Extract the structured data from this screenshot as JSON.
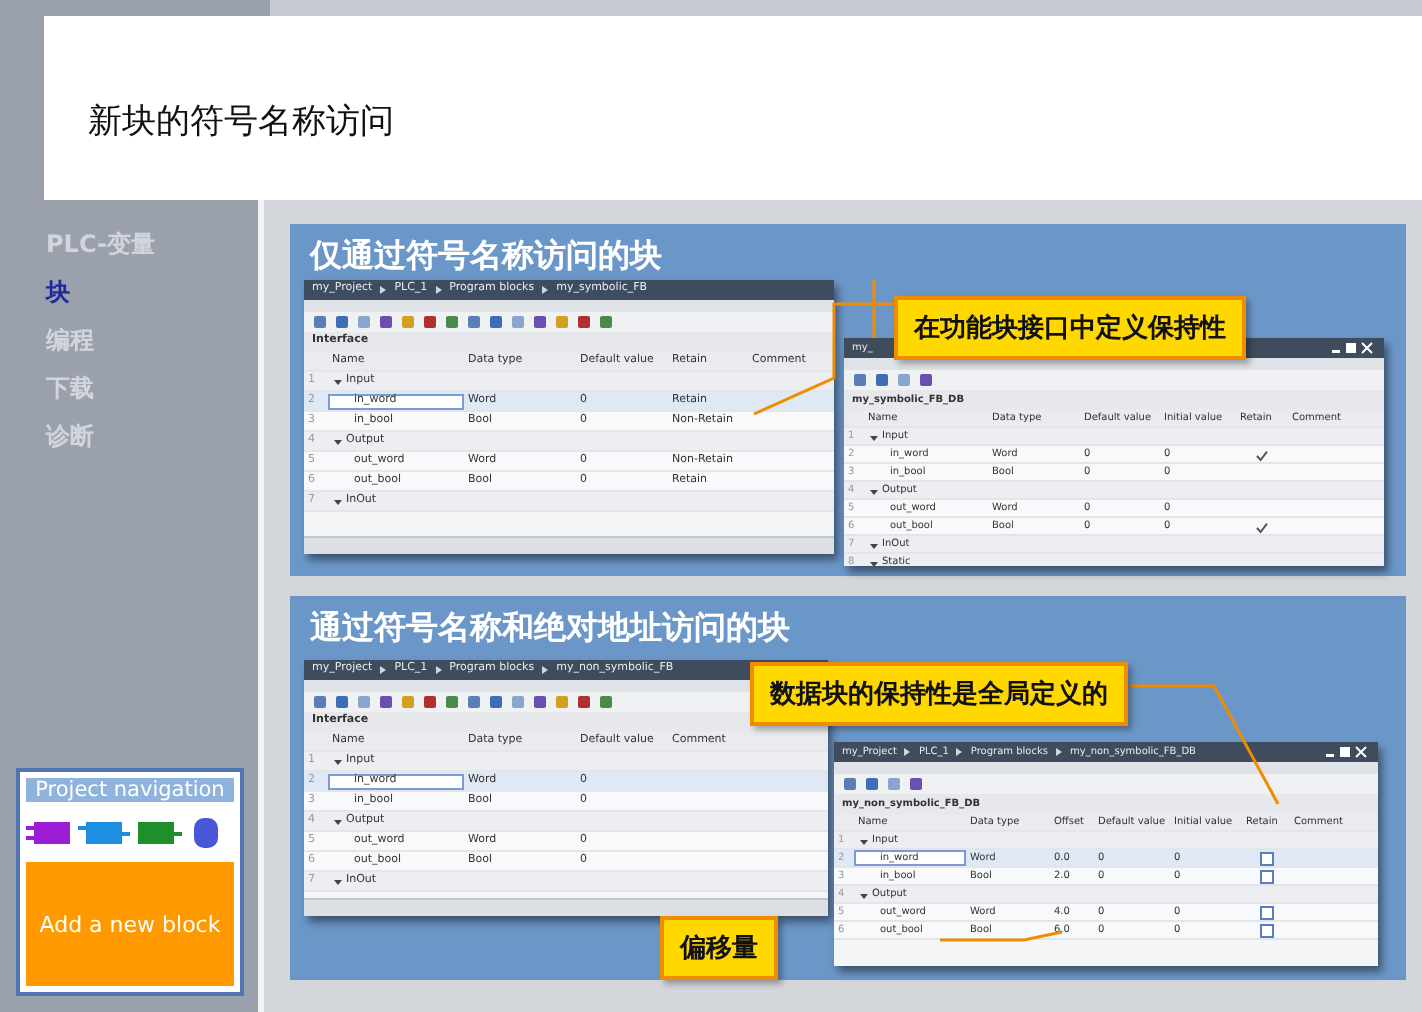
{
  "title": "新块的符号名称访问",
  "nav": [
    {
      "label": "PLC-变量",
      "selected": false
    },
    {
      "label": "块",
      "selected": true
    },
    {
      "label": "编程",
      "selected": false
    },
    {
      "label": "下载",
      "selected": false
    },
    {
      "label": "诊断",
      "selected": false
    }
  ],
  "project_navigation": {
    "title": "Project navigation",
    "button": "Add a new block"
  },
  "sections": [
    {
      "heading": "仅通过符号名称访问的块",
      "editor": {
        "breadcrumb": [
          "my_Project",
          "PLC_1",
          "Program blocks",
          "my_symbolic_FB"
        ],
        "section_title": "Interface",
        "columns": [
          "Name",
          "Data type",
          "Default value",
          "Retain",
          "Comment"
        ],
        "rows": [
          {
            "num": "1",
            "kind": "group",
            "name": "Input",
            "selected": false
          },
          {
            "num": "2",
            "kind": "var",
            "name": "in_word",
            "selected": true,
            "cells": [
              "Word",
              "0",
              "Retain"
            ]
          },
          {
            "num": "3",
            "kind": "var",
            "name": "in_bool",
            "selected": false,
            "cells": [
              "Bool",
              "0",
              "Non-Retain"
            ]
          },
          {
            "num": "4",
            "kind": "group",
            "name": "Output",
            "selected": false
          },
          {
            "num": "5",
            "kind": "var",
            "name": "out_word",
            "selected": false,
            "cells": [
              "Word",
              "0",
              "Non-Retain"
            ]
          },
          {
            "num": "6",
            "kind": "var",
            "name": "out_bool",
            "selected": false,
            "cells": [
              "Bool",
              "0",
              "Retain"
            ]
          },
          {
            "num": "7",
            "kind": "group",
            "name": "InOut",
            "selected": false
          }
        ]
      },
      "db": {
        "breadcrumb": [
          "my_"
        ],
        "section_title": "my_symbolic_FB_DB",
        "kind": "ticks",
        "columns": [
          "Name",
          "Data type",
          "Default value",
          "Initial value",
          "Retain",
          "Comment"
        ],
        "rows": [
          {
            "num": "1",
            "kind": "group",
            "name": "Input",
            "selected": false
          },
          {
            "num": "2",
            "kind": "var",
            "name": "in_word",
            "selected": false,
            "cells": [
              "Word",
              "0",
              "0"
            ],
            "retain": true
          },
          {
            "num": "3",
            "kind": "var",
            "name": "in_bool",
            "selected": false,
            "cells": [
              "Bool",
              "0",
              "0"
            ],
            "retain": false
          },
          {
            "num": "4",
            "kind": "group",
            "name": "Output",
            "selected": false
          },
          {
            "num": "5",
            "kind": "var",
            "name": "out_word",
            "selected": false,
            "cells": [
              "Word",
              "0",
              "0"
            ],
            "retain": false
          },
          {
            "num": "6",
            "kind": "var",
            "name": "out_bool",
            "selected": false,
            "cells": [
              "Bool",
              "0",
              "0"
            ],
            "retain": true
          },
          {
            "num": "7",
            "kind": "group",
            "name": "InOut",
            "selected": false
          },
          {
            "num": "8",
            "kind": "group",
            "name": "Static",
            "selected": false
          }
        ]
      },
      "callouts": [
        {
          "text": "在功能块接口中定义保持性"
        }
      ]
    },
    {
      "heading": "通过符号名称和绝对地址访问的块",
      "editor": {
        "breadcrumb": [
          "my_Project",
          "PLC_1",
          "Program blocks",
          "my_non_symbolic_FB"
        ],
        "section_title": "Interface",
        "columns": [
          "Name",
          "Data type",
          "Default value",
          "Comment"
        ],
        "rows": [
          {
            "num": "1",
            "kind": "group",
            "name": "Input",
            "selected": false
          },
          {
            "num": "2",
            "kind": "var",
            "name": "in_word",
            "selected": true,
            "cells": [
              "Word",
              "0"
            ]
          },
          {
            "num": "3",
            "kind": "var",
            "name": "in_bool",
            "selected": false,
            "cells": [
              "Bool",
              "0"
            ]
          },
          {
            "num": "4",
            "kind": "group",
            "name": "Output",
            "selected": false
          },
          {
            "num": "5",
            "kind": "var",
            "name": "out_word",
            "selected": false,
            "cells": [
              "Word",
              "0"
            ]
          },
          {
            "num": "6",
            "kind": "var",
            "name": "out_bool",
            "selected": false,
            "cells": [
              "Bool",
              "0"
            ]
          },
          {
            "num": "7",
            "kind": "group",
            "name": "InOut",
            "selected": false
          }
        ]
      },
      "db": {
        "breadcrumb": [
          "my_Project",
          "PLC_1",
          "Program blocks",
          "my_non_symbolic_FB_DB"
        ],
        "section_title": "my_non_symbolic_FB_DB",
        "kind": "checkboxes",
        "columns": [
          "Name",
          "Data type",
          "Offset",
          "Default value",
          "Initial value",
          "Retain",
          "Comment"
        ],
        "rows": [
          {
            "num": "1",
            "kind": "group",
            "name": "Input",
            "selected": false
          },
          {
            "num": "2",
            "kind": "var",
            "name": "in_word",
            "selected": true,
            "cells": [
              "Word",
              "0.0",
              "0",
              "0"
            ],
            "retain": false
          },
          {
            "num": "3",
            "kind": "var",
            "name": "in_bool",
            "selected": false,
            "cells": [
              "Bool",
              "2.0",
              "0",
              "0"
            ],
            "retain": false
          },
          {
            "num": "4",
            "kind": "group",
            "name": "Output",
            "selected": false
          },
          {
            "num": "5",
            "kind": "var",
            "name": "out_word",
            "selected": false,
            "cells": [
              "Word",
              "4.0",
              "0",
              "0"
            ],
            "retain": false
          },
          {
            "num": "6",
            "kind": "var",
            "name": "out_bool",
            "selected": false,
            "cells": [
              "Bool",
              "6.0",
              "0",
              "0"
            ],
            "retain": false
          }
        ]
      },
      "callouts": [
        {
          "text": "数据块的保持性是全局定义的"
        },
        {
          "text": "偏移量"
        }
      ]
    }
  ]
}
